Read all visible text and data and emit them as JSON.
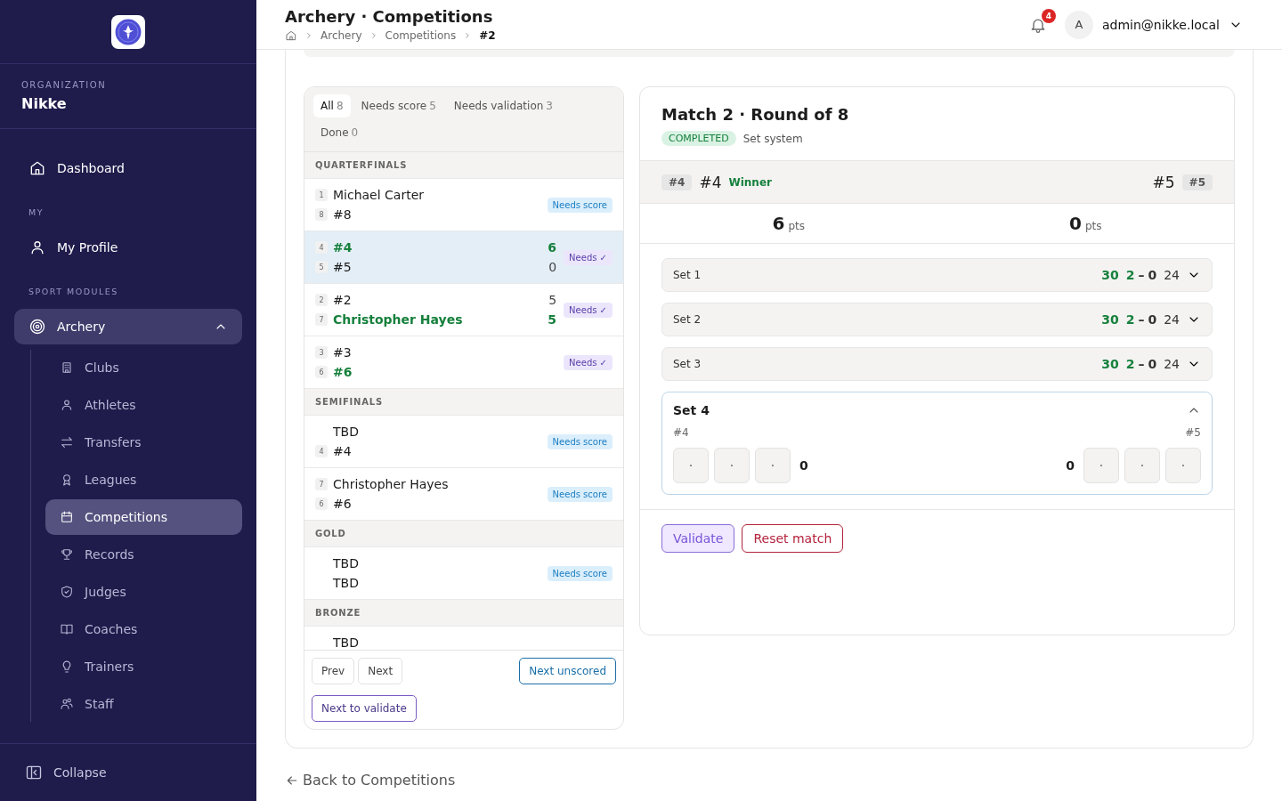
{
  "sidebar": {
    "organization_label": "ORGANIZATION",
    "organization": "Nikke",
    "nav": [
      {
        "kind": "item",
        "label": "Dashboard",
        "selected": false
      },
      {
        "kind": "heading",
        "label": "MY"
      },
      {
        "kind": "item",
        "label": "My Profile",
        "selected": false
      },
      {
        "kind": "heading",
        "label": "SPORT MODULES"
      },
      {
        "kind": "group",
        "label": "Archery",
        "expanded": true,
        "children": [
          {
            "label": "Clubs",
            "selected": false
          },
          {
            "label": "Athletes",
            "selected": false
          },
          {
            "label": "Transfers",
            "selected": false
          },
          {
            "label": "Leagues",
            "selected": false
          },
          {
            "label": "Competitions",
            "selected": true
          },
          {
            "label": "Records",
            "selected": false
          },
          {
            "label": "Judges",
            "selected": false
          },
          {
            "label": "Coaches",
            "selected": false
          },
          {
            "label": "Trainers",
            "selected": false
          },
          {
            "label": "Staff",
            "selected": false
          }
        ]
      }
    ],
    "collapse": "Collapse"
  },
  "header": {
    "title": "Archery · Competitions",
    "breadcrumb": [
      "Archery",
      "Competitions",
      "#2"
    ],
    "notifications": "4",
    "avatar": "A",
    "user": "admin@nikke.local"
  },
  "bracket": {
    "tabs": [
      {
        "label": "All",
        "count": "8",
        "selected": true
      },
      {
        "label": "Needs score",
        "count": "5",
        "selected": false
      },
      {
        "label": "Needs validation",
        "count": "3",
        "selected": false
      },
      {
        "label": "Done",
        "count": "0",
        "selected": false
      }
    ],
    "rounds": [
      {
        "title": "QUARTERFINALS",
        "matches": [
          {
            "selected": false,
            "status": "Needs score",
            "kind": "score",
            "entrants": [
              {
                "seed": "1",
                "name": "Michael Carter",
                "winner": false
              },
              {
                "seed": "8",
                "name": "#8",
                "winner": false
              }
            ]
          },
          {
            "selected": true,
            "status": "Needs ✓",
            "kind": "validate",
            "entrants": [
              {
                "seed": "4",
                "name": "#4",
                "winner": true,
                "score": "6"
              },
              {
                "seed": "5",
                "name": "#5",
                "winner": false,
                "score": "0"
              }
            ]
          },
          {
            "selected": false,
            "status": "Needs ✓",
            "kind": "validate",
            "entrants": [
              {
                "seed": "2",
                "name": "#2",
                "winner": false,
                "score": "5"
              },
              {
                "seed": "7",
                "name": "Christopher Hayes",
                "winner": true,
                "score": "5"
              }
            ]
          },
          {
            "selected": false,
            "status": "Needs ✓",
            "kind": "validate",
            "entrants": [
              {
                "seed": "3",
                "name": "#3",
                "winner": false
              },
              {
                "seed": "6",
                "name": "#6",
                "winner": true
              }
            ]
          }
        ]
      },
      {
        "title": "SEMIFINALS",
        "matches": [
          {
            "selected": false,
            "status": "Needs score",
            "kind": "score",
            "entrants": [
              {
                "name": "TBD",
                "winner": false
              },
              {
                "seed": "4",
                "name": "#4",
                "winner": false
              }
            ]
          },
          {
            "selected": false,
            "status": "Needs score",
            "kind": "score",
            "entrants": [
              {
                "seed": "7",
                "name": "Christopher Hayes",
                "winner": false
              },
              {
                "seed": "6",
                "name": "#6",
                "winner": false
              }
            ]
          }
        ]
      },
      {
        "title": "GOLD",
        "matches": [
          {
            "selected": false,
            "status": "Needs score",
            "kind": "score",
            "entrants": [
              {
                "name": "TBD",
                "winner": false
              },
              {
                "name": "TBD",
                "winner": false
              }
            ]
          }
        ]
      },
      {
        "title": "BRONZE",
        "matches": [
          {
            "selected": false,
            "entrants": [
              {
                "name": "TBD",
                "winner": false
              }
            ]
          }
        ]
      }
    ],
    "buttons": [
      {
        "label": "Prev",
        "kind": "plain"
      },
      {
        "label": "Next",
        "kind": "plain"
      },
      {
        "label": "Next unscored",
        "kind": "primary"
      },
      {
        "label": "Next to validate",
        "kind": "validate"
      }
    ]
  },
  "match": {
    "title": "Match 2 · Round of 8",
    "status": "COMPLETED",
    "format": "Set system",
    "winner_label": "Winner",
    "left": {
      "tag": "#4",
      "name": "#4",
      "winner": true,
      "points": "6",
      "unit": "pts"
    },
    "right": {
      "tag": "#5",
      "name": "#5",
      "winner": false,
      "points": "0",
      "unit": "pts"
    },
    "sets": [
      {
        "label": "Set 1",
        "expanded": false,
        "left_won": true,
        "left_total": "30",
        "left_points": "2",
        "separator": "–",
        "right_points": "0",
        "right_total": "24"
      },
      {
        "label": "Set 2",
        "expanded": false,
        "left_won": true,
        "left_total": "30",
        "left_points": "2",
        "separator": "–",
        "right_points": "0",
        "right_total": "24"
      },
      {
        "label": "Set 3",
        "expanded": false,
        "left_won": true,
        "left_total": "30",
        "left_points": "2",
        "separator": "–",
        "right_points": "0",
        "right_total": "24"
      },
      {
        "label": "Set 4",
        "expanded": true,
        "left_name": "#4",
        "right_name": "#5",
        "left_arrows": [
          {
            "placeholder": "·"
          },
          {
            "placeholder": "·"
          },
          {
            "placeholder": "·"
          }
        ],
        "left_total": "0",
        "right_total": "0",
        "right_arrows": [
          {
            "placeholder": "·"
          },
          {
            "placeholder": "·"
          },
          {
            "placeholder": "·"
          }
        ]
      }
    ],
    "actions": [
      {
        "label": "Validate",
        "kind": "validate"
      },
      {
        "label": "Reset match",
        "kind": "danger"
      }
    ]
  },
  "back_link": "Back to Competitions"
}
